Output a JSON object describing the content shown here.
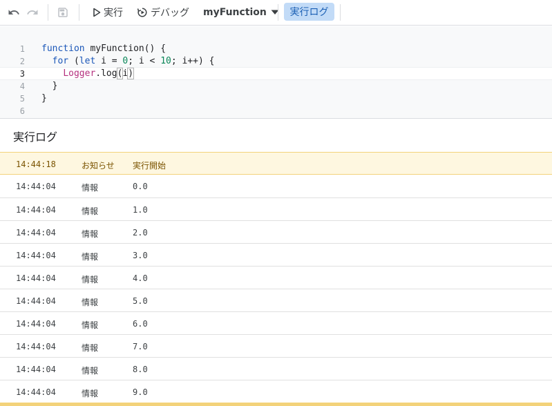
{
  "toolbar": {
    "undo_icon": "undo-icon",
    "redo_icon": "redo-icon",
    "save_icon": "save-icon",
    "run_label": "実行",
    "debug_label": "デバッグ",
    "function_select": "myFunction",
    "log_button": "実行ログ",
    "accent_color": "#1a5fb4",
    "highlight_color": "#c2dbf7"
  },
  "editor": {
    "active_line": 3,
    "lines": [
      {
        "number": "1",
        "text": "function myFunction() {"
      },
      {
        "number": "2",
        "text": "  for (let i = 0; i < 10; i++) {"
      },
      {
        "number": "3",
        "text": "    Logger.log(i)"
      },
      {
        "number": "4",
        "text": "  }"
      },
      {
        "number": "5",
        "text": "}"
      },
      {
        "number": "6",
        "text": ""
      }
    ]
  },
  "log": {
    "title": "実行ログ",
    "notice_color": "#fef7e0",
    "entries": [
      {
        "time": "14:44:18",
        "level": "お知らせ",
        "message": "実行開始"
      },
      {
        "time": "14:44:04",
        "level": "情報",
        "message": "0.0"
      },
      {
        "time": "14:44:04",
        "level": "情報",
        "message": "1.0"
      },
      {
        "time": "14:44:04",
        "level": "情報",
        "message": "2.0"
      },
      {
        "time": "14:44:04",
        "level": "情報",
        "message": "3.0"
      },
      {
        "time": "14:44:04",
        "level": "情報",
        "message": "4.0"
      },
      {
        "time": "14:44:04",
        "level": "情報",
        "message": "5.0"
      },
      {
        "time": "14:44:04",
        "level": "情報",
        "message": "6.0"
      },
      {
        "time": "14:44:04",
        "level": "情報",
        "message": "7.0"
      },
      {
        "time": "14:44:04",
        "level": "情報",
        "message": "8.0"
      },
      {
        "time": "14:44:04",
        "level": "情報",
        "message": "9.0"
      }
    ]
  }
}
